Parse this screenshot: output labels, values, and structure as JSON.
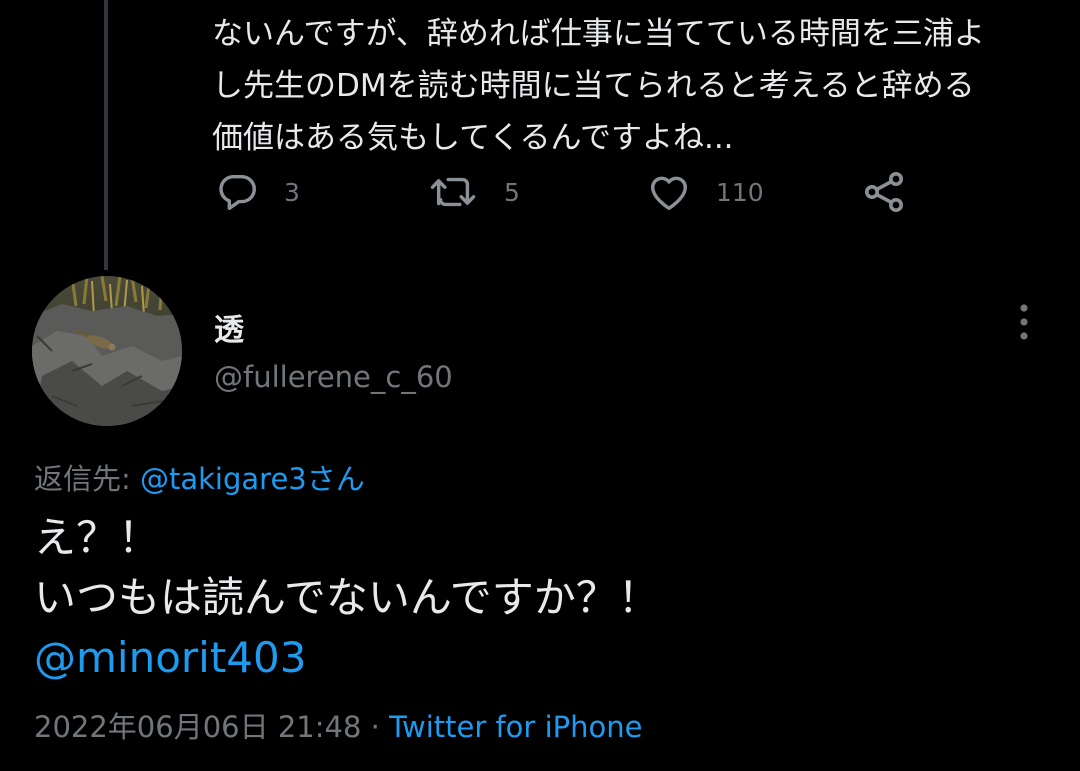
{
  "previous_tweet": {
    "text_lines": [
      "ないんですが、辞めれば仕事に当てている時間を三浦よ",
      "し先生のDMを読む時間に当てられると考えると辞める",
      "価値はある気もしてくるんですよね..."
    ],
    "actions": {
      "reply": {
        "icon": "reply-icon",
        "count": "3"
      },
      "retweet": {
        "icon": "retweet-icon",
        "count": "5"
      },
      "like": {
        "icon": "heart-icon",
        "count": "110"
      },
      "share": {
        "icon": "share-icon"
      }
    }
  },
  "tweet": {
    "display_name": "透",
    "handle": "@fullerene_c_60",
    "reply_to_label": "返信先: ",
    "reply_to_mention": "@takigare3さん",
    "body_lines": [
      "え？！",
      "いつもは読んでないんですか？！"
    ],
    "body_mention": "@minorit403",
    "timestamp": "2022年06月06日 21:48",
    "separator": " · ",
    "source": "Twitter for iPhone"
  },
  "colors": {
    "background": "#000000",
    "text": "#e7e9ea",
    "secondary": "#71767b",
    "accent": "#1d9bf0"
  }
}
